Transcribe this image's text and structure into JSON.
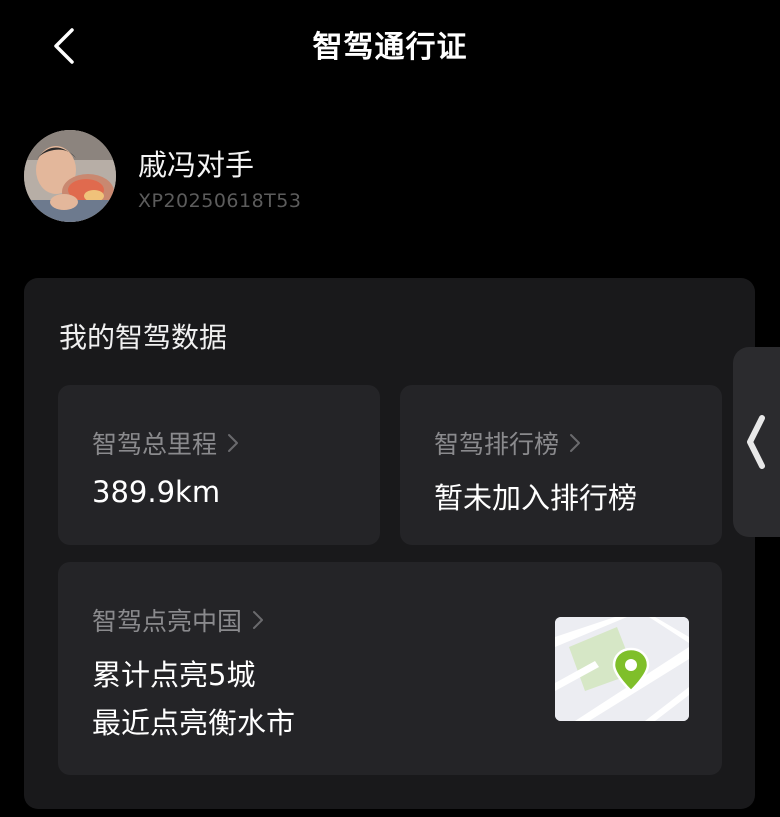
{
  "header": {
    "title": "智驾通行证",
    "back_icon": "chevron-left-icon"
  },
  "profile": {
    "name": "戚冯对手",
    "id": "XP20250618T53"
  },
  "data_card": {
    "title": "我的智驾数据",
    "mileage": {
      "label": "智驾总里程",
      "value": "389.9km"
    },
    "leaderboard": {
      "label": "智驾排行榜",
      "value": "暂未加入排行榜"
    },
    "light_up": {
      "label": "智驾点亮中国",
      "line1": "累计点亮5城",
      "line2": "最近点亮衡水市",
      "map_icon": "map-pin-icon"
    }
  },
  "side_handle": {
    "icon": "chevron-left-icon"
  },
  "colors": {
    "background": "#000000",
    "card": "#19191b",
    "tile": "#242427",
    "muted_text": "#8a8a8d",
    "pin_green": "#7fbf2a"
  }
}
